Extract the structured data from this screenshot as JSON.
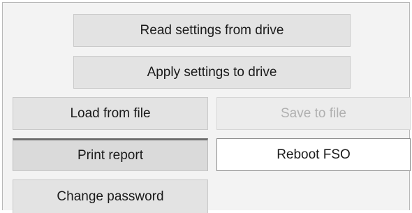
{
  "buttons": {
    "read_settings": "Read settings from drive",
    "apply_settings": "Apply settings to drive",
    "load_from_file": "Load from file",
    "save_to_file": "Save to file",
    "print_report": "Print report",
    "reboot_fso": "Reboot FSO",
    "change_password": "Change password"
  },
  "colors": {
    "panel_background": "#f3f3f3",
    "button_background": "#e3e3e3",
    "disabled_text": "#b0b0b0",
    "text": "#1a1a1a"
  }
}
